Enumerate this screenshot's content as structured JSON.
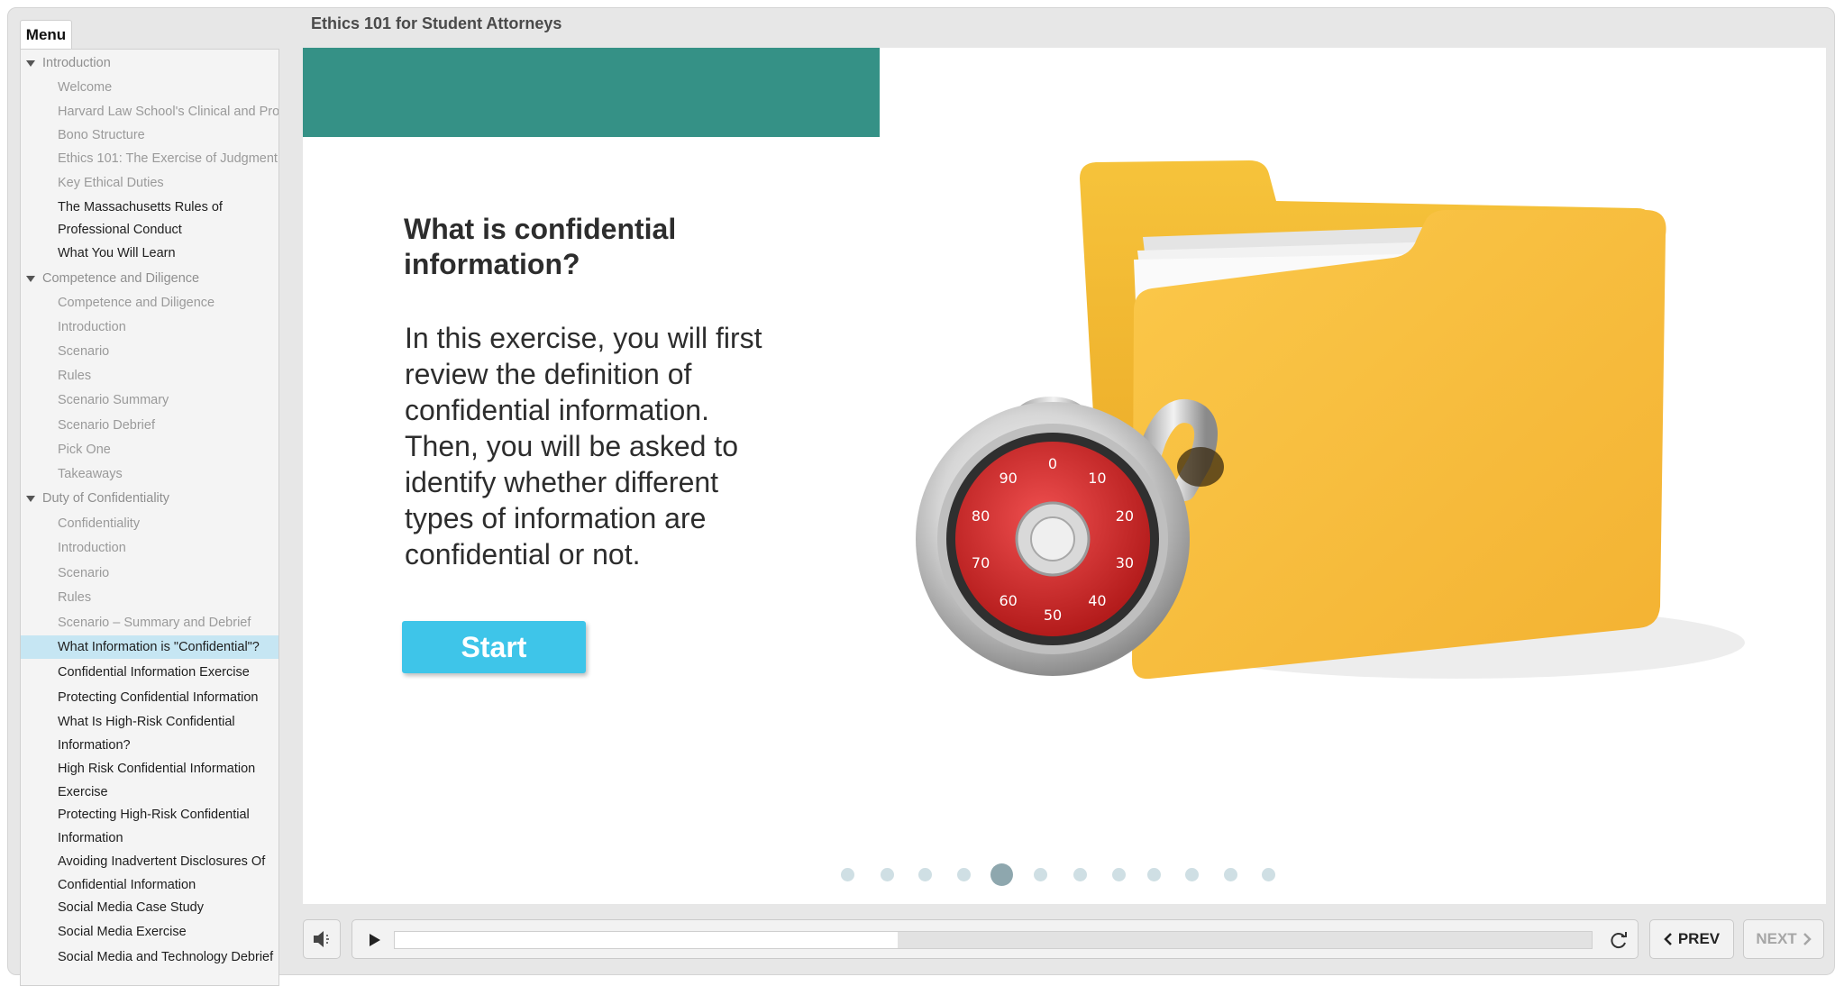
{
  "course": {
    "title": "Ethics 101 for Student Attorneys"
  },
  "menu": {
    "tab_label": "Menu",
    "items": [
      {
        "label": "Introduction",
        "kind": "section"
      },
      {
        "label": "Welcome",
        "kind": "visited"
      },
      {
        "label": "Harvard Law School's Clinical and Pro",
        "kind": "visited"
      },
      {
        "label": "Bono Structure",
        "kind": "visited"
      },
      {
        "label": "Ethics 101: The Exercise of Judgment",
        "kind": "visited"
      },
      {
        "label": "Key Ethical Duties",
        "kind": "visited"
      },
      {
        "label": "The Massachusetts Rules of",
        "kind": "normal"
      },
      {
        "label": "Professional Conduct",
        "kind": "normal"
      },
      {
        "label": "What You Will Learn",
        "kind": "normal"
      },
      {
        "label": "Competence and Diligence",
        "kind": "section"
      },
      {
        "label": "Competence and Diligence",
        "kind": "visited"
      },
      {
        "label": "Introduction",
        "kind": "visited"
      },
      {
        "label": "Scenario",
        "kind": "visited"
      },
      {
        "label": "Rules",
        "kind": "visited"
      },
      {
        "label": "Scenario Summary",
        "kind": "visited"
      },
      {
        "label": "Scenario Debrief",
        "kind": "visited"
      },
      {
        "label": "Pick One",
        "kind": "visited"
      },
      {
        "label": "Takeaways",
        "kind": "visited"
      },
      {
        "label": "Duty of Confidentiality",
        "kind": "section"
      },
      {
        "label": "Confidentiality",
        "kind": "visited"
      },
      {
        "label": "Introduction",
        "kind": "visited"
      },
      {
        "label": "Scenario",
        "kind": "visited"
      },
      {
        "label": "Rules",
        "kind": "visited"
      },
      {
        "label": "Scenario – Summary and Debrief",
        "kind": "visited"
      },
      {
        "label": "What Information is \"Confidential\"?",
        "kind": "selected"
      },
      {
        "label": "Confidential Information Exercise",
        "kind": "normal"
      },
      {
        "label": "Protecting Confidential Information",
        "kind": "normal"
      },
      {
        "label": "What Is High-Risk Confidential",
        "kind": "normal"
      },
      {
        "label": "Information?",
        "kind": "normal"
      },
      {
        "label": "High Risk Confidential Information",
        "kind": "normal"
      },
      {
        "label": "Exercise",
        "kind": "normal"
      },
      {
        "label": "Protecting High-Risk Confidential",
        "kind": "normal"
      },
      {
        "label": "Information",
        "kind": "normal"
      },
      {
        "label": "Avoiding Inadvertent Disclosures Of",
        "kind": "normal"
      },
      {
        "label": "Confidential Information",
        "kind": "normal"
      },
      {
        "label": "Social Media Case Study",
        "kind": "normal"
      },
      {
        "label": "Social Media Exercise",
        "kind": "normal"
      },
      {
        "label": "Social Media and Technology Debrief",
        "kind": "normal"
      }
    ]
  },
  "slide": {
    "heading": "What is confidential information?",
    "body": "In this exercise, you will first review the definition of confidential information. Then, you will be asked to identify whether different types of information are confidential or not.",
    "start_label": "Start",
    "accent_color": "#359186",
    "button_color": "#3ec5e9",
    "illustration_icon": "folder-with-combination-lock",
    "dial_numbers": [
      "0",
      "10",
      "20",
      "30",
      "40",
      "50",
      "60",
      "70",
      "80",
      "90"
    ],
    "progress_dots": {
      "count": 12,
      "active_index": 4
    }
  },
  "playbar": {
    "progress": 0.42,
    "prev_label": "PREV",
    "next_label": "NEXT",
    "icons": [
      "volume-icon",
      "play-icon",
      "replay-icon"
    ]
  }
}
